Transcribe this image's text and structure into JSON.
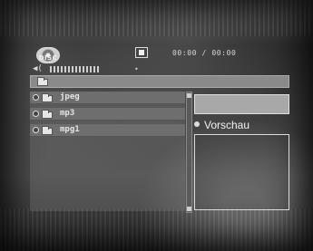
{
  "header": {
    "disc_label": "DISC",
    "time_display": "00:00 / 00:00",
    "volume_level_bars": 14
  },
  "icons": {
    "disc": "disc-icon",
    "stop": "stop-icon",
    "volume": "speaker-icon",
    "folder": "folder-icon",
    "radio": "radio-icon"
  },
  "file_list": {
    "items": [
      {
        "label": "jpeg"
      },
      {
        "label": "mp3"
      },
      {
        "label": "mpg1"
      }
    ]
  },
  "preview": {
    "label": "Vorschau"
  },
  "colors": {
    "row_bg": "#6e6e6e",
    "path_bar_bg": "#8a8a8a",
    "preview_bar_bg": "#a8a8a8"
  }
}
